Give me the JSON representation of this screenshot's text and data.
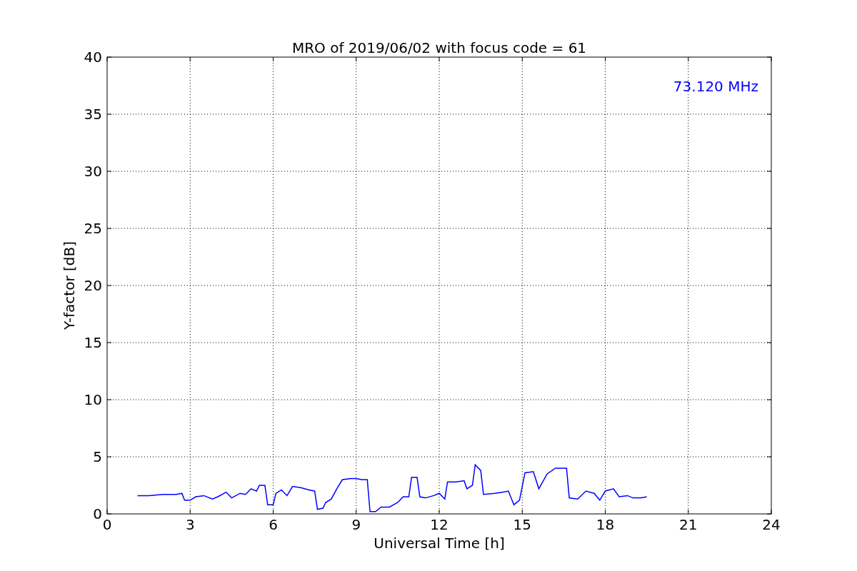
{
  "chart_data": {
    "type": "line",
    "title": "MRO of 2019/06/02 with focus code = 61",
    "xlabel": "Universal Time [h]",
    "ylabel": "Y-factor [dB]",
    "x": [
      1.1,
      1.5,
      2.0,
      2.5,
      2.7,
      2.8,
      3.0,
      3.2,
      3.5,
      3.8,
      4.0,
      4.3,
      4.5,
      4.8,
      5.0,
      5.2,
      5.4,
      5.5,
      5.7,
      5.8,
      6.0,
      6.1,
      6.3,
      6.5,
      6.7,
      7.0,
      7.3,
      7.5,
      7.6,
      7.8,
      7.9,
      8.1,
      8.3,
      8.5,
      8.8,
      9.0,
      9.2,
      9.4,
      9.5,
      9.7,
      9.9,
      10.2,
      10.5,
      10.7,
      10.9,
      11.0,
      11.2,
      11.3,
      11.5,
      11.8,
      12.0,
      12.2,
      12.3,
      12.6,
      12.9,
      13.0,
      13.2,
      13.3,
      13.5,
      13.6,
      14.0,
      14.3,
      14.5,
      14.7,
      14.9,
      15.1,
      15.4,
      15.6,
      15.9,
      16.2,
      16.6,
      16.7,
      17.0,
      17.3,
      17.6,
      17.8,
      18.0,
      18.3,
      18.5,
      18.8,
      19.0,
      19.3,
      19.5
    ],
    "series": [
      {
        "color": "#0000ff",
        "values": [
          1.6,
          1.6,
          1.7,
          1.7,
          1.8,
          1.2,
          1.2,
          1.5,
          1.6,
          1.3,
          1.5,
          1.9,
          1.4,
          1.8,
          1.7,
          2.2,
          2.0,
          2.5,
          2.5,
          0.8,
          0.8,
          1.8,
          2.1,
          1.6,
          2.4,
          2.3,
          2.1,
          2.0,
          0.4,
          0.5,
          1.0,
          1.3,
          2.2,
          3.0,
          3.1,
          3.1,
          3.0,
          3.0,
          0.2,
          0.2,
          0.6,
          0.6,
          1.0,
          1.5,
          1.5,
          3.2,
          3.2,
          1.5,
          1.4,
          1.6,
          1.8,
          1.3,
          2.8,
          2.8,
          2.9,
          2.2,
          2.5,
          4.3,
          3.8,
          1.7,
          1.8,
          1.9,
          2.0,
          0.8,
          1.2,
          3.6,
          3.7,
          2.2,
          3.5,
          4.0,
          4.0,
          1.4,
          1.3,
          2.0,
          1.8,
          1.2,
          2.0,
          2.2,
          1.5,
          1.6,
          1.4,
          1.4,
          1.5
        ]
      }
    ],
    "xlim": [
      0,
      24
    ],
    "ylim": [
      0,
      40
    ],
    "xticks": [
      0,
      3,
      6,
      9,
      12,
      15,
      18,
      21,
      24
    ],
    "yticks": [
      0,
      5,
      10,
      15,
      20,
      25,
      30,
      35,
      40
    ],
    "grid": true,
    "annotations": [
      {
        "text": "73.120 MHz"
      }
    ]
  }
}
